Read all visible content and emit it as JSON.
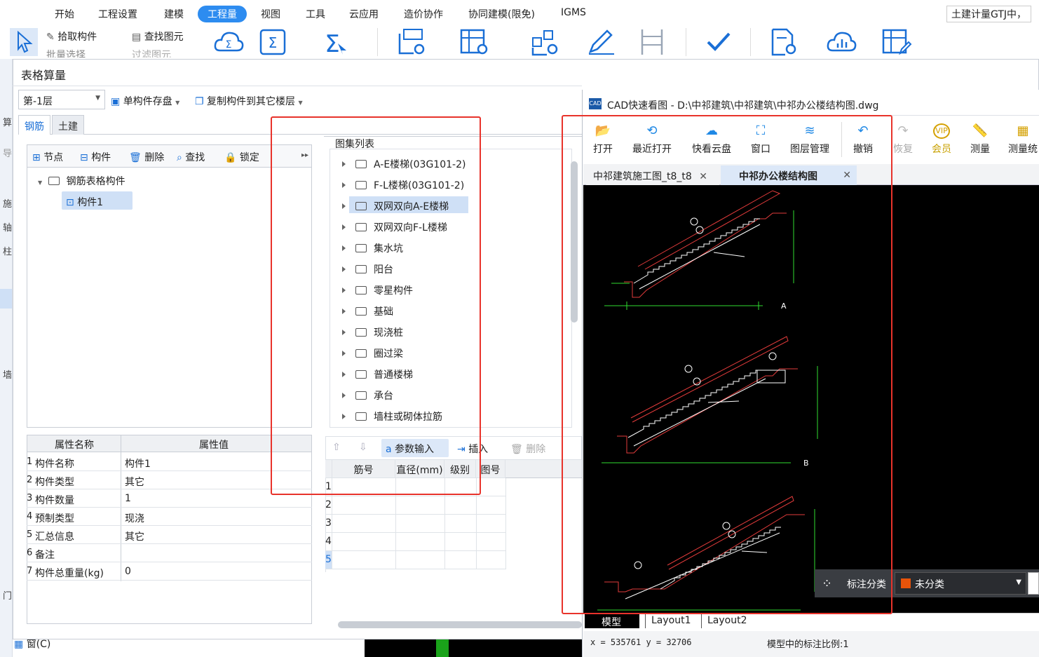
{
  "menubar": {
    "items": [
      "开始",
      "工程设置",
      "建模",
      "工程量",
      "视图",
      "工具",
      "云应用",
      "造价协作",
      "协同建模(限免)",
      "IGMS"
    ],
    "active": "工程量",
    "right_text": "土建计量GTJ中，"
  },
  "ribbon": {
    "pick_component": "拾取构件",
    "find_element": "查找图元",
    "batch_select": "批量选择",
    "filter_element": "过滤图元"
  },
  "left_strip": [
    "算",
    "导",
    "施",
    "轴",
    "柱",
    "墙",
    "门",
    "窗(C)"
  ],
  "dialog": {
    "title": "表格算量",
    "floor": "第-1层",
    "save_component": "单构件存盘",
    "copy_to_floor": "复制构件到其它楼层",
    "tabs": [
      "钢筋",
      "土建"
    ],
    "active_tab": "钢筋",
    "tree_toolbar": [
      "节点",
      "构件",
      "删除",
      "查找",
      "锁定"
    ],
    "tree": {
      "root": "钢筋表格构件",
      "child": "构件1"
    },
    "props": {
      "col_name": "属性名称",
      "col_value": "属性值",
      "rows": [
        {
          "num": "1",
          "name": "构件名称",
          "value": "构件1"
        },
        {
          "num": "2",
          "name": "构件类型",
          "value": "其它"
        },
        {
          "num": "3",
          "name": "构件数量",
          "value": "1"
        },
        {
          "num": "4",
          "name": "预制类型",
          "value": "现浇"
        },
        {
          "num": "5",
          "name": "汇总信息",
          "value": "其它"
        },
        {
          "num": "6",
          "name": "备注",
          "value": ""
        },
        {
          "num": "7",
          "name": "构件总重量(kg)",
          "value": "0"
        }
      ]
    },
    "atlas": {
      "title": "图集列表",
      "items": [
        "A-E楼梯(03G101-2)",
        "F-L楼梯(03G101-2)",
        "双网双向A-E楼梯",
        "双网双向F-L楼梯",
        "集水坑",
        "阳台",
        "零星构件",
        "基础",
        "现浇桩",
        "圈过梁",
        "普通楼梯",
        "承台",
        "墙柱或砌体拉筋"
      ],
      "selected": "双网双向A-E楼梯"
    },
    "rebar_toolbar": {
      "param_input": "参数输入",
      "insert": "插入",
      "delete": "删除"
    },
    "rebar_grid": {
      "headers": [
        "筋号",
        "直径(mm)",
        "级别",
        "图号"
      ],
      "row_nums": [
        "1",
        "2",
        "3",
        "4",
        "5"
      ]
    }
  },
  "cad": {
    "title": "CAD快速看图 - D:\\中祁建筑\\中祁建筑\\中祁办公楼结构图.dwg",
    "toolbar": [
      "打开",
      "最近打开",
      "快看云盘",
      "窗口",
      "图层管理",
      "撤销",
      "恢复",
      "会员",
      "测量",
      "测量统"
    ],
    "doc_tabs": [
      "中祁建筑施工图_t8_t8",
      "中祁办公楼结构图"
    ],
    "active_doc": "中祁办公楼结构图",
    "layout_tabs": [
      "模型",
      "Layout1",
      "Layout2"
    ],
    "annot_label": "标注分类",
    "annot_value": "未分类",
    "coords": "x = 535761  y = 32706",
    "scale_text": "模型中的标注比例:1",
    "drawing_labels": [
      "A",
      "B"
    ]
  },
  "colors": {
    "accent": "#2d8cf0",
    "highlight_red": "#e8332b",
    "cad_bg": "#000000"
  }
}
